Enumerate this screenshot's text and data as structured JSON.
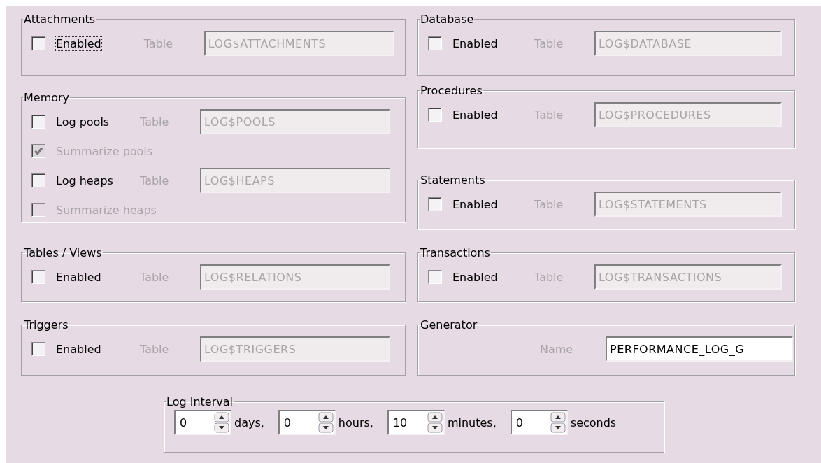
{
  "columns": [
    {
      "groups": [
        {
          "title": "Attachments",
          "rows": [
            {
              "kind": "table",
              "label": "Enabled",
              "checked": false,
              "disabled": false,
              "focused": true,
              "table_label": "Table",
              "table_value": "LOG$ATTACHMENTS"
            }
          ]
        },
        {
          "title": "Memory",
          "rows": [
            {
              "kind": "table",
              "label": "Log pools",
              "checked": false,
              "disabled": false,
              "focused": false,
              "table_label": "Table",
              "table_value": "LOG$POOLS"
            },
            {
              "kind": "check",
              "label": "Summarize pools",
              "checked": true,
              "disabled": true,
              "focused": false
            },
            {
              "kind": "table",
              "label": "Log heaps",
              "checked": false,
              "disabled": false,
              "focused": false,
              "table_label": "Table",
              "table_value": "LOG$HEAPS"
            },
            {
              "kind": "check",
              "label": "Summarize heaps",
              "checked": false,
              "disabled": true,
              "focused": false
            }
          ]
        },
        {
          "title": "Tables / Views",
          "rows": [
            {
              "kind": "table",
              "label": "Enabled",
              "checked": false,
              "disabled": false,
              "focused": false,
              "table_label": "Table",
              "table_value": "LOG$RELATIONS"
            }
          ]
        },
        {
          "title": "Triggers",
          "rows": [
            {
              "kind": "table",
              "label": "Enabled",
              "checked": false,
              "disabled": false,
              "focused": false,
              "table_label": "Table",
              "table_value": "LOG$TRIGGERS"
            }
          ]
        }
      ]
    },
    {
      "groups": [
        {
          "title": "Database",
          "rows": [
            {
              "kind": "table",
              "label": "Enabled",
              "checked": false,
              "disabled": false,
              "focused": false,
              "table_label": "Table",
              "table_value": "LOG$DATABASE"
            }
          ]
        },
        {
          "title": "Procedures",
          "rows": [
            {
              "kind": "table",
              "label": "Enabled",
              "checked": false,
              "disabled": false,
              "focused": false,
              "table_label": "Table",
              "table_value": "LOG$PROCEDURES"
            }
          ]
        },
        {
          "title": "Statements",
          "rows": [
            {
              "kind": "table",
              "label": "Enabled",
              "checked": false,
              "disabled": false,
              "focused": false,
              "table_label": "Table",
              "table_value": "LOG$STATEMENTS"
            }
          ]
        },
        {
          "title": "Transactions",
          "rows": [
            {
              "kind": "table",
              "label": "Enabled",
              "checked": false,
              "disabled": false,
              "focused": false,
              "table_label": "Table",
              "table_value": "LOG$TRANSACTIONS"
            }
          ]
        },
        {
          "title": "Generator",
          "rows": [
            {
              "kind": "name",
              "name_label": "Name",
              "value": "PERFORMANCE_LOG_G"
            }
          ]
        }
      ]
    }
  ],
  "log_interval": {
    "title": "Log Interval",
    "fields": [
      {
        "value": "0",
        "unit": "days,"
      },
      {
        "value": "0",
        "unit": "hours,"
      },
      {
        "value": "10",
        "unit": "minutes,"
      },
      {
        "value": "0",
        "unit": "seconds"
      }
    ]
  }
}
